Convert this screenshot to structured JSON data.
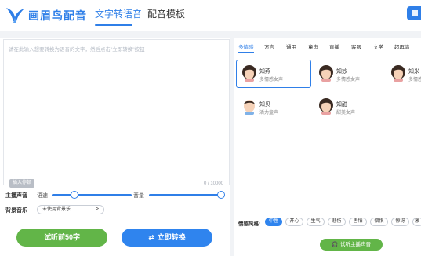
{
  "header": {
    "brand": "画眉鸟配音",
    "tabs": [
      {
        "label": "文字转语音",
        "active": true
      },
      {
        "label": "配音模板",
        "active": false
      }
    ]
  },
  "editor": {
    "placeholder": "请在此输入想要转换为语音的文字，然后点击\"立即转换\"按钮",
    "insert_pause": "插入停顿",
    "char_count": "0 / 10000"
  },
  "controls": {
    "voice_label": "主播声音",
    "speed_label": "语速",
    "speed_value": 0.28,
    "volume_label": "音量",
    "volume_value": 1.0,
    "bgm_label": "背景音乐",
    "bgm_value": "未使用背景乐",
    "bgm_chevron": ">"
  },
  "actions": {
    "preview": "试听前50字",
    "convert": "立即转换"
  },
  "categories": [
    "多情感",
    "方言",
    "通用",
    "童声",
    "直播",
    "客服",
    "文学",
    "超再清"
  ],
  "voices": [
    {
      "name": "知燕",
      "desc": "多情感女声",
      "selected": true
    },
    {
      "name": "知妙",
      "desc": "多情感女声",
      "selected": false
    },
    {
      "name": "知米",
      "desc": "多情感女",
      "selected": false
    },
    {
      "name": "知贝",
      "desc": "活力童声",
      "selected": false
    },
    {
      "name": "知甜",
      "desc": "甜美女声",
      "selected": false
    }
  ],
  "emotion": {
    "label": "情感风格:",
    "chips": [
      {
        "label": "中性",
        "active": true
      },
      {
        "label": "开心",
        "active": false
      },
      {
        "label": "生气",
        "active": false
      },
      {
        "label": "悲伤",
        "active": false
      },
      {
        "label": "害怕",
        "active": false
      },
      {
        "label": "憎恨",
        "active": false
      },
      {
        "label": "惊讶",
        "active": false
      },
      {
        "label": "激",
        "active": false
      }
    ]
  },
  "listen_button": "试听主播声音",
  "colors": {
    "accent": "#2f7fe8",
    "green": "#62b548",
    "background": "#f1f3f6"
  },
  "icons": {
    "logo": "bird-logo-icon",
    "convert": "swap-arrows-icon",
    "listen": "headphones-icon"
  }
}
